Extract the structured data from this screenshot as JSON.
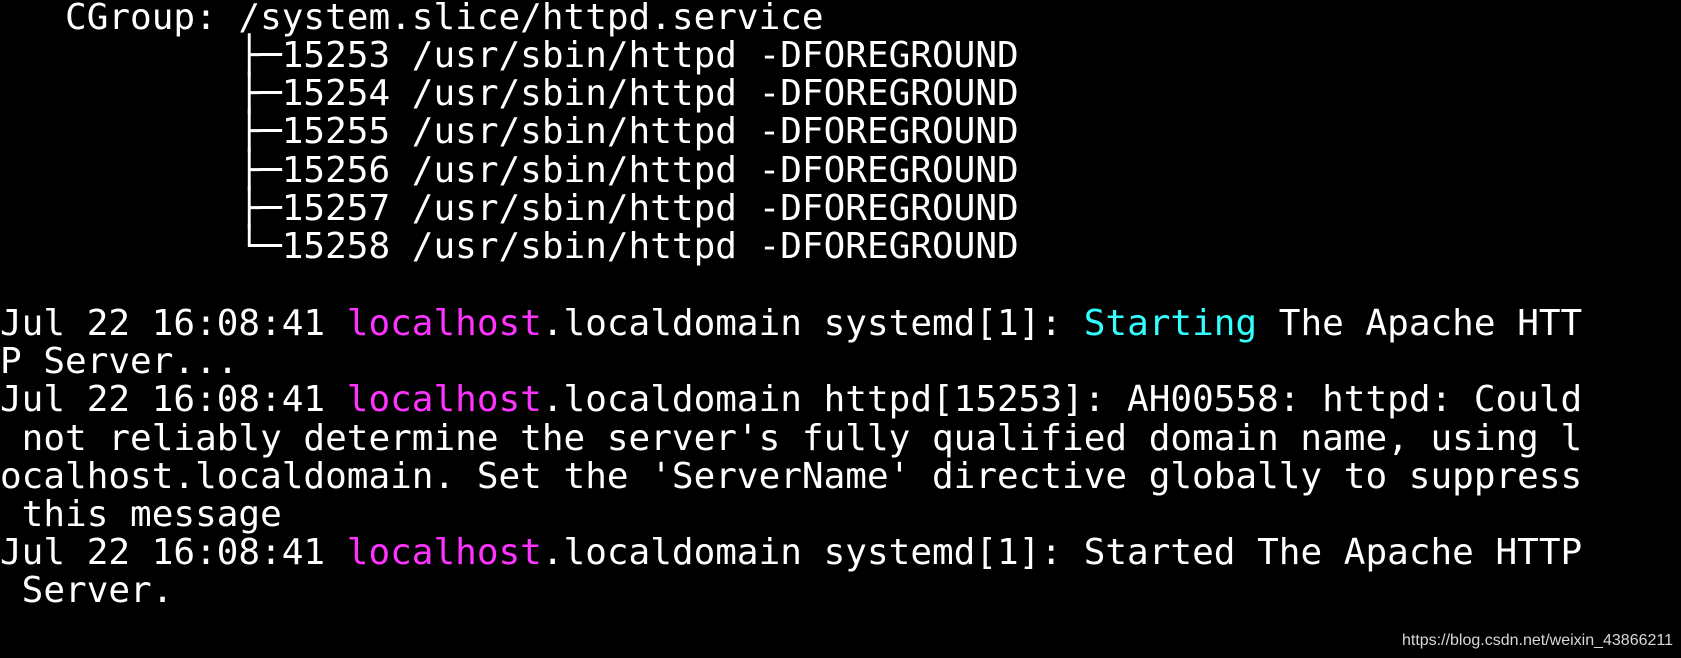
{
  "cgroup": {
    "line": "   CGroup: /system.slice/httpd.service",
    "tree": [
      "           ├─15253 /usr/sbin/httpd -DFOREGROUND",
      "           ├─15254 /usr/sbin/httpd -DFOREGROUND",
      "           ├─15255 /usr/sbin/httpd -DFOREGROUND",
      "           ├─15256 /usr/sbin/httpd -DFOREGROUND",
      "           ├─15257 /usr/sbin/httpd -DFOREGROUND",
      "           └─15258 /usr/sbin/httpd -DFOREGROUND"
    ]
  },
  "log": [
    {
      "prefix": "Jul 22 16:08:41 ",
      "host_highlight": "localhost",
      "mid": ".localdomain systemd[1]: ",
      "status_highlight": "Starting",
      "rest": " The Apache HTT",
      "wrap": [
        "P Server..."
      ]
    },
    {
      "prefix": "Jul 22 16:08:41 ",
      "host_highlight": "localhost",
      "mid": ".localdomain httpd[15253]: AH00558: httpd: Could",
      "wrap": [
        " not reliably determine the server's fully qualified domain name, using l",
        "ocalhost.localdomain. Set the 'ServerName' directive globally to suppress",
        " this message"
      ]
    },
    {
      "prefix": "Jul 22 16:08:41 ",
      "host_highlight": "localhost",
      "mid": ".localdomain systemd[1]: Started The Apache HTTP",
      "wrap": [
        " Server."
      ]
    }
  ],
  "watermark": "https://blog.csdn.net/weixin_43866211",
  "colors": {
    "background": "#000000",
    "text": "#ffffff",
    "hostname_highlight": "#ff33ff",
    "status_highlight": "#33ffff"
  }
}
